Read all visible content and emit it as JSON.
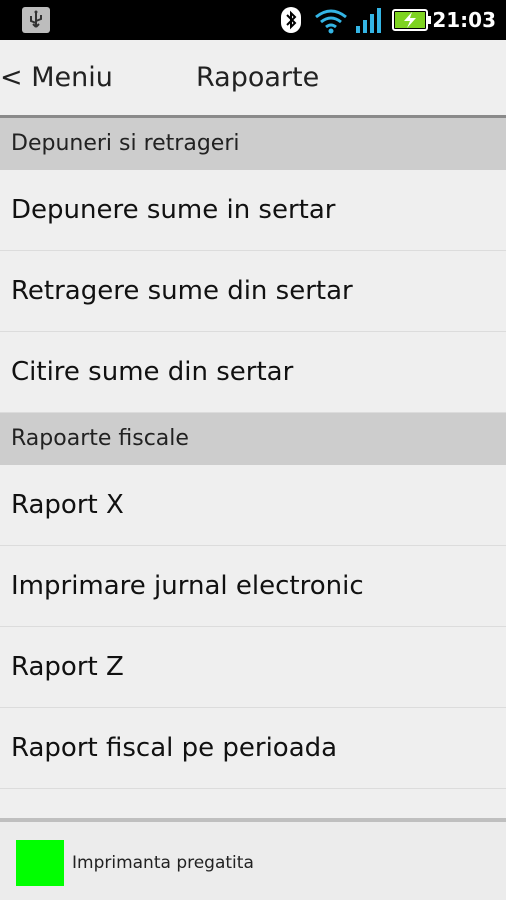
{
  "status_bar": {
    "time": "21:03",
    "icons": [
      "usb-icon",
      "bluetooth-icon",
      "wifi-icon",
      "signal-icon",
      "battery-charging-icon"
    ]
  },
  "header": {
    "back_label": "< Meniu",
    "title": "Rapoarte"
  },
  "sections": [
    {
      "header": "Depuneri si retrageri",
      "items": [
        "Depunere sume in sertar",
        "Retragere sume din sertar",
        "Citire sume din sertar"
      ]
    },
    {
      "header": "Rapoarte fiscale",
      "items": [
        "Raport X",
        "Imprimare jurnal electronic",
        "Raport Z",
        "Raport fiscal pe perioada"
      ]
    }
  ],
  "footer": {
    "status_text": "Imprimanta pregatita",
    "status_color": "#00ff00"
  }
}
